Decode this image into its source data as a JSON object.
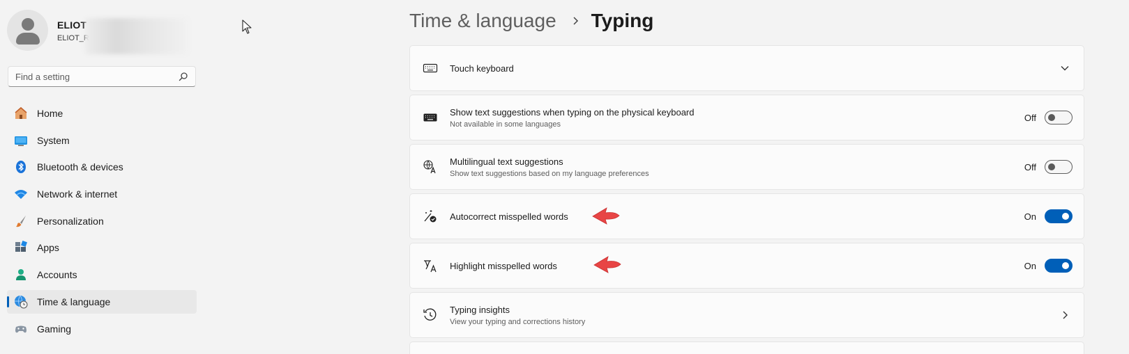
{
  "profile": {
    "name": "ELIOT I",
    "email": "ELIOT_R"
  },
  "search": {
    "placeholder": "Find a setting"
  },
  "nav": [
    {
      "label": "Home",
      "icon": "home-icon"
    },
    {
      "label": "System",
      "icon": "system-icon"
    },
    {
      "label": "Bluetooth & devices",
      "icon": "bluetooth-icon"
    },
    {
      "label": "Network & internet",
      "icon": "wifi-icon"
    },
    {
      "label": "Personalization",
      "icon": "brush-icon"
    },
    {
      "label": "Apps",
      "icon": "apps-icon"
    },
    {
      "label": "Accounts",
      "icon": "accounts-icon"
    },
    {
      "label": "Time & language",
      "icon": "globe-clock-icon",
      "active": true
    },
    {
      "label": "Gaming",
      "icon": "gamepad-icon"
    }
  ],
  "breadcrumb": {
    "parent": "Time & language",
    "current": "Typing"
  },
  "settings": [
    {
      "title": "Touch keyboard",
      "subtitle": "",
      "icon": "keyboard-icon",
      "control": "expand"
    },
    {
      "title": "Show text suggestions when typing on the physical keyboard",
      "subtitle": "Not available in some languages",
      "icon": "keyboard-solid-icon",
      "control": "toggle",
      "state": "Off"
    },
    {
      "title": "Multilingual text suggestions",
      "subtitle": "Show text suggestions based on my language preferences",
      "icon": "language-icon",
      "control": "toggle",
      "state": "Off"
    },
    {
      "title": "Autocorrect misspelled words",
      "subtitle": "",
      "icon": "autocorrect-icon",
      "control": "toggle",
      "state": "On"
    },
    {
      "title": "Highlight misspelled words",
      "subtitle": "",
      "icon": "highlight-text-icon",
      "control": "toggle",
      "state": "On"
    },
    {
      "title": "Typing insights",
      "subtitle": "View your typing and corrections history",
      "icon": "history-icon",
      "control": "navigate"
    }
  ],
  "colors": {
    "accent": "#005fb8",
    "annotation_arrow": "#e84545"
  }
}
